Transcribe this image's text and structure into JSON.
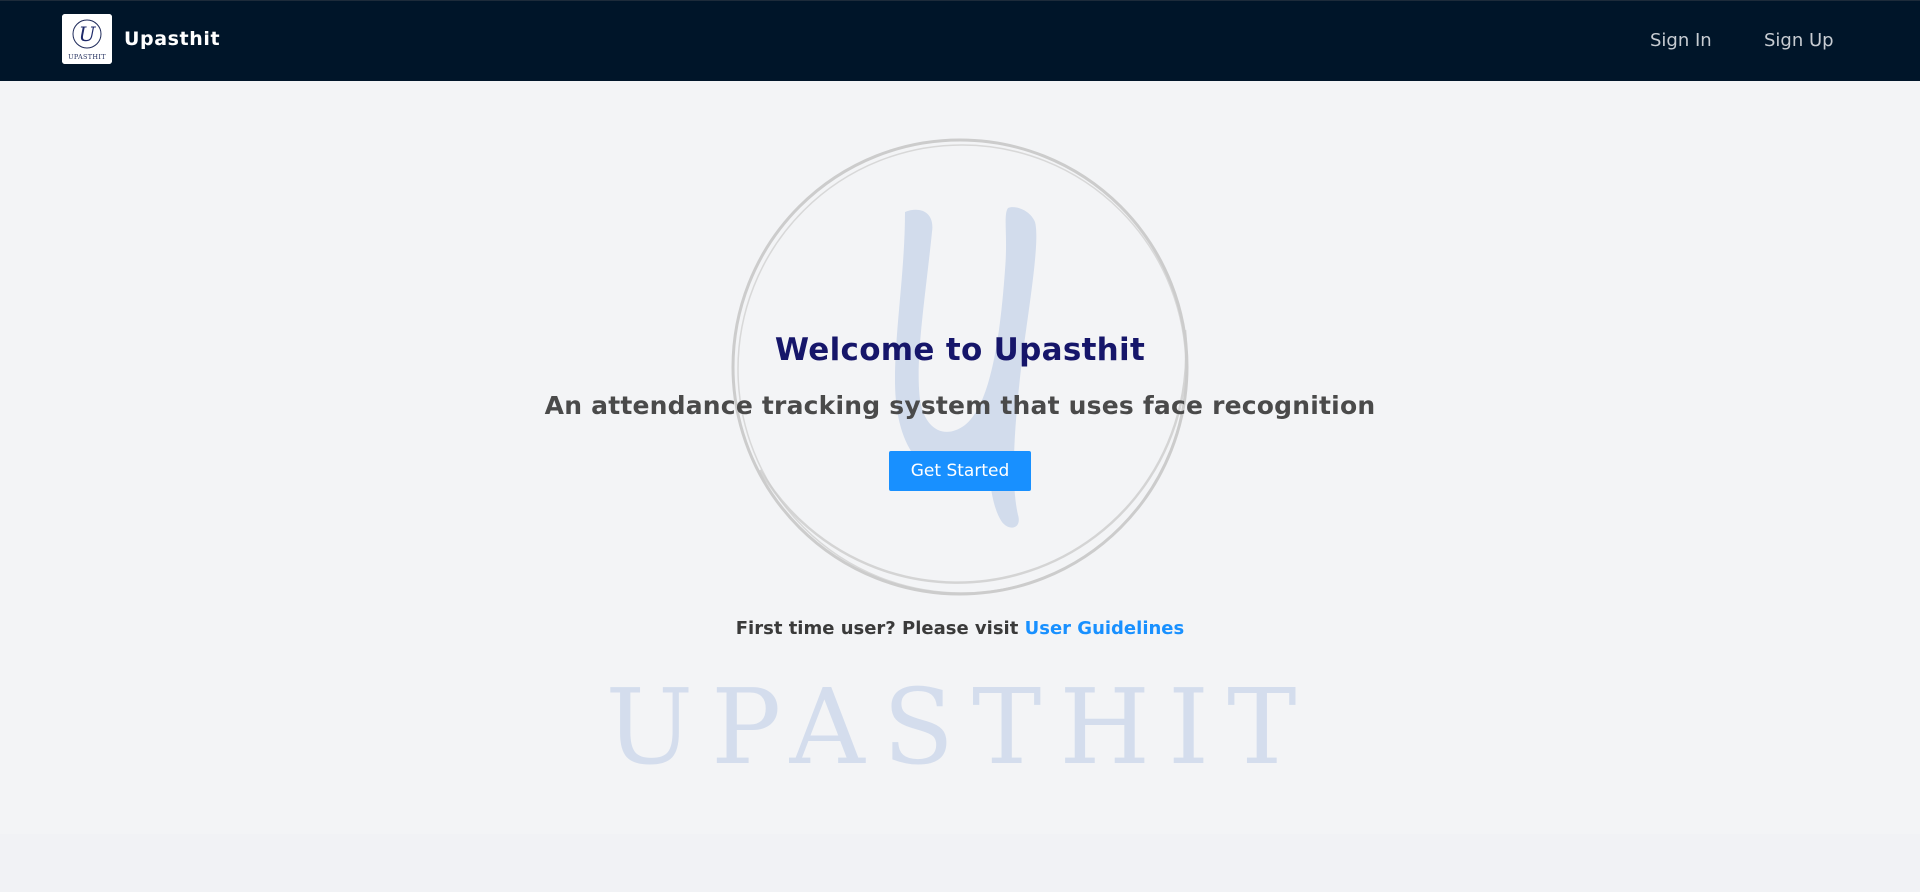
{
  "navbar": {
    "brand_name": "Upasthit",
    "logo_letter": "U",
    "logo_caption": "UPASTHIT",
    "links": [
      {
        "label": "Sign In"
      },
      {
        "label": "Sign Up"
      }
    ]
  },
  "hero": {
    "title": "Welcome to Upasthit",
    "subtitle": "An attendance tracking system that uses face recognition",
    "cta_label": "Get Started",
    "watermark_text": "UPASTHIT",
    "guidelines_prefix": "First time user? Please visit",
    "guidelines_link_label": "User Guidelines"
  },
  "colors": {
    "navbar_bg": "#001529",
    "page_bg": "#f3f4f6",
    "accent": "#1890ff",
    "title": "#16166a",
    "watermark": "#c9d6ea",
    "ring": "#c8c8c8"
  }
}
